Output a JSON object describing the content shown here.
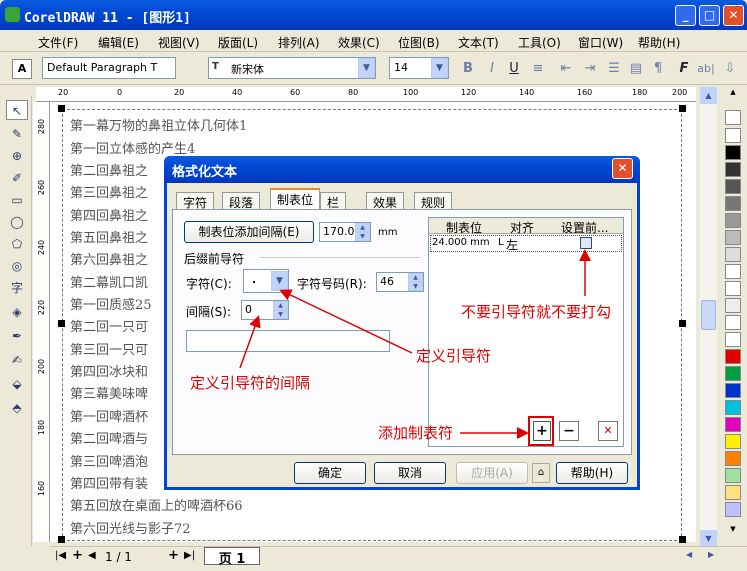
{
  "app": {
    "title": "CorelDRAW 11 - [图形1]",
    "min": "_",
    "max": "□",
    "close": "✕"
  },
  "menu": [
    "文件(F)",
    "编辑(E)",
    "视图(V)",
    "版面(L)",
    "排列(A)",
    "效果(C)",
    "位图(B)",
    "文本(T)",
    "工具(O)",
    "窗口(W)",
    "帮助(H)"
  ],
  "props": {
    "style": "Default Paragraph T",
    "font": "新宋体",
    "size": "14"
  },
  "ruler_h": [
    "20",
    "0",
    "20",
    "40",
    "60",
    "80",
    "100",
    "120",
    "140",
    "160",
    "180",
    "200"
  ],
  "ruler_v": [
    "280",
    "260",
    "240",
    "220",
    "200",
    "180",
    "160"
  ],
  "content_lines": [
    "第一幕万物的鼻祖立体几何体1",
    "第一回立体感的产生4",
    "第二回鼻祖之",
    "第三回鼻祖之",
    "第四回鼻祖之",
    "第五回鼻祖之",
    "第六回鼻祖之",
    "第二幕凯口凯",
    "第一回质感25",
    "第二回一只可",
    "第三回一只可",
    "第四回冰块和",
    "第三幕美味啤",
    "第一回啤酒杯",
    "第二回啤酒与",
    "第三回啤酒泡",
    "第四回带有装",
    "第五回放在桌面上的啤酒杯66",
    "第六回光线与影子72"
  ],
  "dialog": {
    "title": "格式化文本",
    "tabs": [
      "字符",
      "段落",
      "制表位",
      "栏",
      "效果",
      "规则"
    ],
    "add_tab_button": "制表位添加间隔(E)",
    "spacing_value": "170.0",
    "unit": "mm",
    "leader_heading": "后缀前导符",
    "char_label": "字符(C):",
    "char_value": ".",
    "char_code_label": "字符号码(R):",
    "char_code_value": "46",
    "spacing_label": "间隔(S):",
    "spacing_val": "0",
    "table_headers": [
      "制表位",
      "对齐",
      "设置前..."
    ],
    "table_row": {
      "position": "24.000 mm",
      "align": "左",
      "leader": ""
    },
    "ok": "确定",
    "cancel": "取消",
    "apply": "应用(A)",
    "help": "帮助(H)"
  },
  "annotations": {
    "no_leader": "不要引导符就不要打勾",
    "define_leader": "定义引导符",
    "define_spacing": "定义引导符的间隔",
    "add_tab": "添加制表符"
  },
  "status": {
    "page_counter": "1 / 1",
    "page_tab": "页 1"
  },
  "colors": {
    "titlebar": "#0249D4",
    "annotation": "#E00000"
  }
}
